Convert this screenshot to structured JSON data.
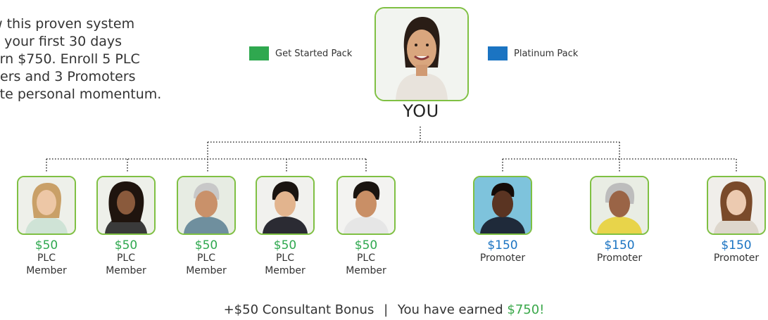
{
  "intro_lines": [
    "w this proven system",
    "n your first 30 days",
    "arn $750. Enroll 5 PLC",
    "bers and 3 Promoters",
    "ate personal momentum."
  ],
  "legend": {
    "get_started": {
      "label": "Get Started Pack",
      "color": "#2fa84f"
    },
    "platinum": {
      "label": "Platinum Pack",
      "color": "#1b74c2"
    }
  },
  "you": {
    "label": "YOU"
  },
  "members": [
    {
      "price": "$50",
      "role_line1": "PLC",
      "role_line2": "Member",
      "pack": "get_started"
    },
    {
      "price": "$50",
      "role_line1": "PLC",
      "role_line2": "Member",
      "pack": "get_started"
    },
    {
      "price": "$50",
      "role_line1": "PLC",
      "role_line2": "Member",
      "pack": "get_started"
    },
    {
      "price": "$50",
      "role_line1": "PLC",
      "role_line2": "Member",
      "pack": "get_started"
    },
    {
      "price": "$50",
      "role_line1": "PLC",
      "role_line2": "Member",
      "pack": "get_started"
    },
    {
      "price": "$150",
      "role_line1": "Promoter",
      "role_line2": "",
      "pack": "platinum"
    },
    {
      "price": "$150",
      "role_line1": "Promoter",
      "role_line2": "",
      "pack": "platinum"
    },
    {
      "price": "$150",
      "role_line1": "Promoter",
      "role_line2": "",
      "pack": "platinum"
    }
  ],
  "footer": {
    "bonus": "+$50 Consultant Bonus",
    "separator": "|",
    "earned_prefix": "You have earned",
    "earned_amount": "$750!"
  },
  "colors": {
    "frame": "#7fc043",
    "green_text": "#2fa84f",
    "blue_text": "#1b74c2",
    "earned": "#3aa84a"
  }
}
